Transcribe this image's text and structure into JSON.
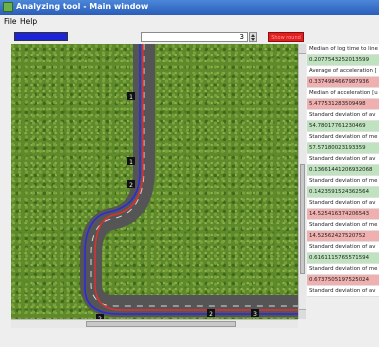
{
  "window": {
    "title": "Analyzing tool - Main window"
  },
  "menu": [
    {
      "label": "File"
    },
    {
      "label": "Help"
    }
  ],
  "toolbar": {
    "frame_value": "3",
    "show_button_label": "Show round",
    "colors": {
      "indicator": "#1d24d8",
      "show_button": "#e22020"
    }
  },
  "map": {
    "markers": [
      {
        "label": "1"
      },
      {
        "label": "1"
      },
      {
        "label": "2"
      },
      {
        "label": "2"
      },
      {
        "label": "2"
      },
      {
        "label": "3"
      }
    ]
  },
  "stats": [
    {
      "label": "Median of log time to line",
      "value": "0.2077543252013599",
      "status": "good"
    },
    {
      "label": "Average of acceleration [",
      "value": "0.3374984667987936",
      "status": "bad"
    },
    {
      "label": "Median of acceleration [u",
      "value": "5.477531283509498",
      "status": "bad"
    },
    {
      "label": "Standard deviation of av",
      "value": "54.78017761230469",
      "status": "good"
    },
    {
      "label": "Standard deviation of me",
      "value": "57.57180023193359",
      "status": "good"
    },
    {
      "label": "Standard deviation of av",
      "value": "0.13661441206932068",
      "status": "good"
    },
    {
      "label": "Standard deviation of me",
      "value": "0.1423591524362564",
      "status": "good"
    },
    {
      "label": "Standard deviation of av",
      "value": "14.525416374206543",
      "status": "bad"
    },
    {
      "label": "Standard deviation of me",
      "value": "14.52562427520752",
      "status": "bad"
    },
    {
      "label": "Standard deviation of av",
      "value": "0.6161115765571594",
      "status": "good"
    },
    {
      "label": "Standard deviation of me",
      "value": "0.6737505197525024",
      "status": "bad"
    },
    {
      "label": "Standard deviation of av",
      "value": "",
      "status": "none"
    }
  ]
}
